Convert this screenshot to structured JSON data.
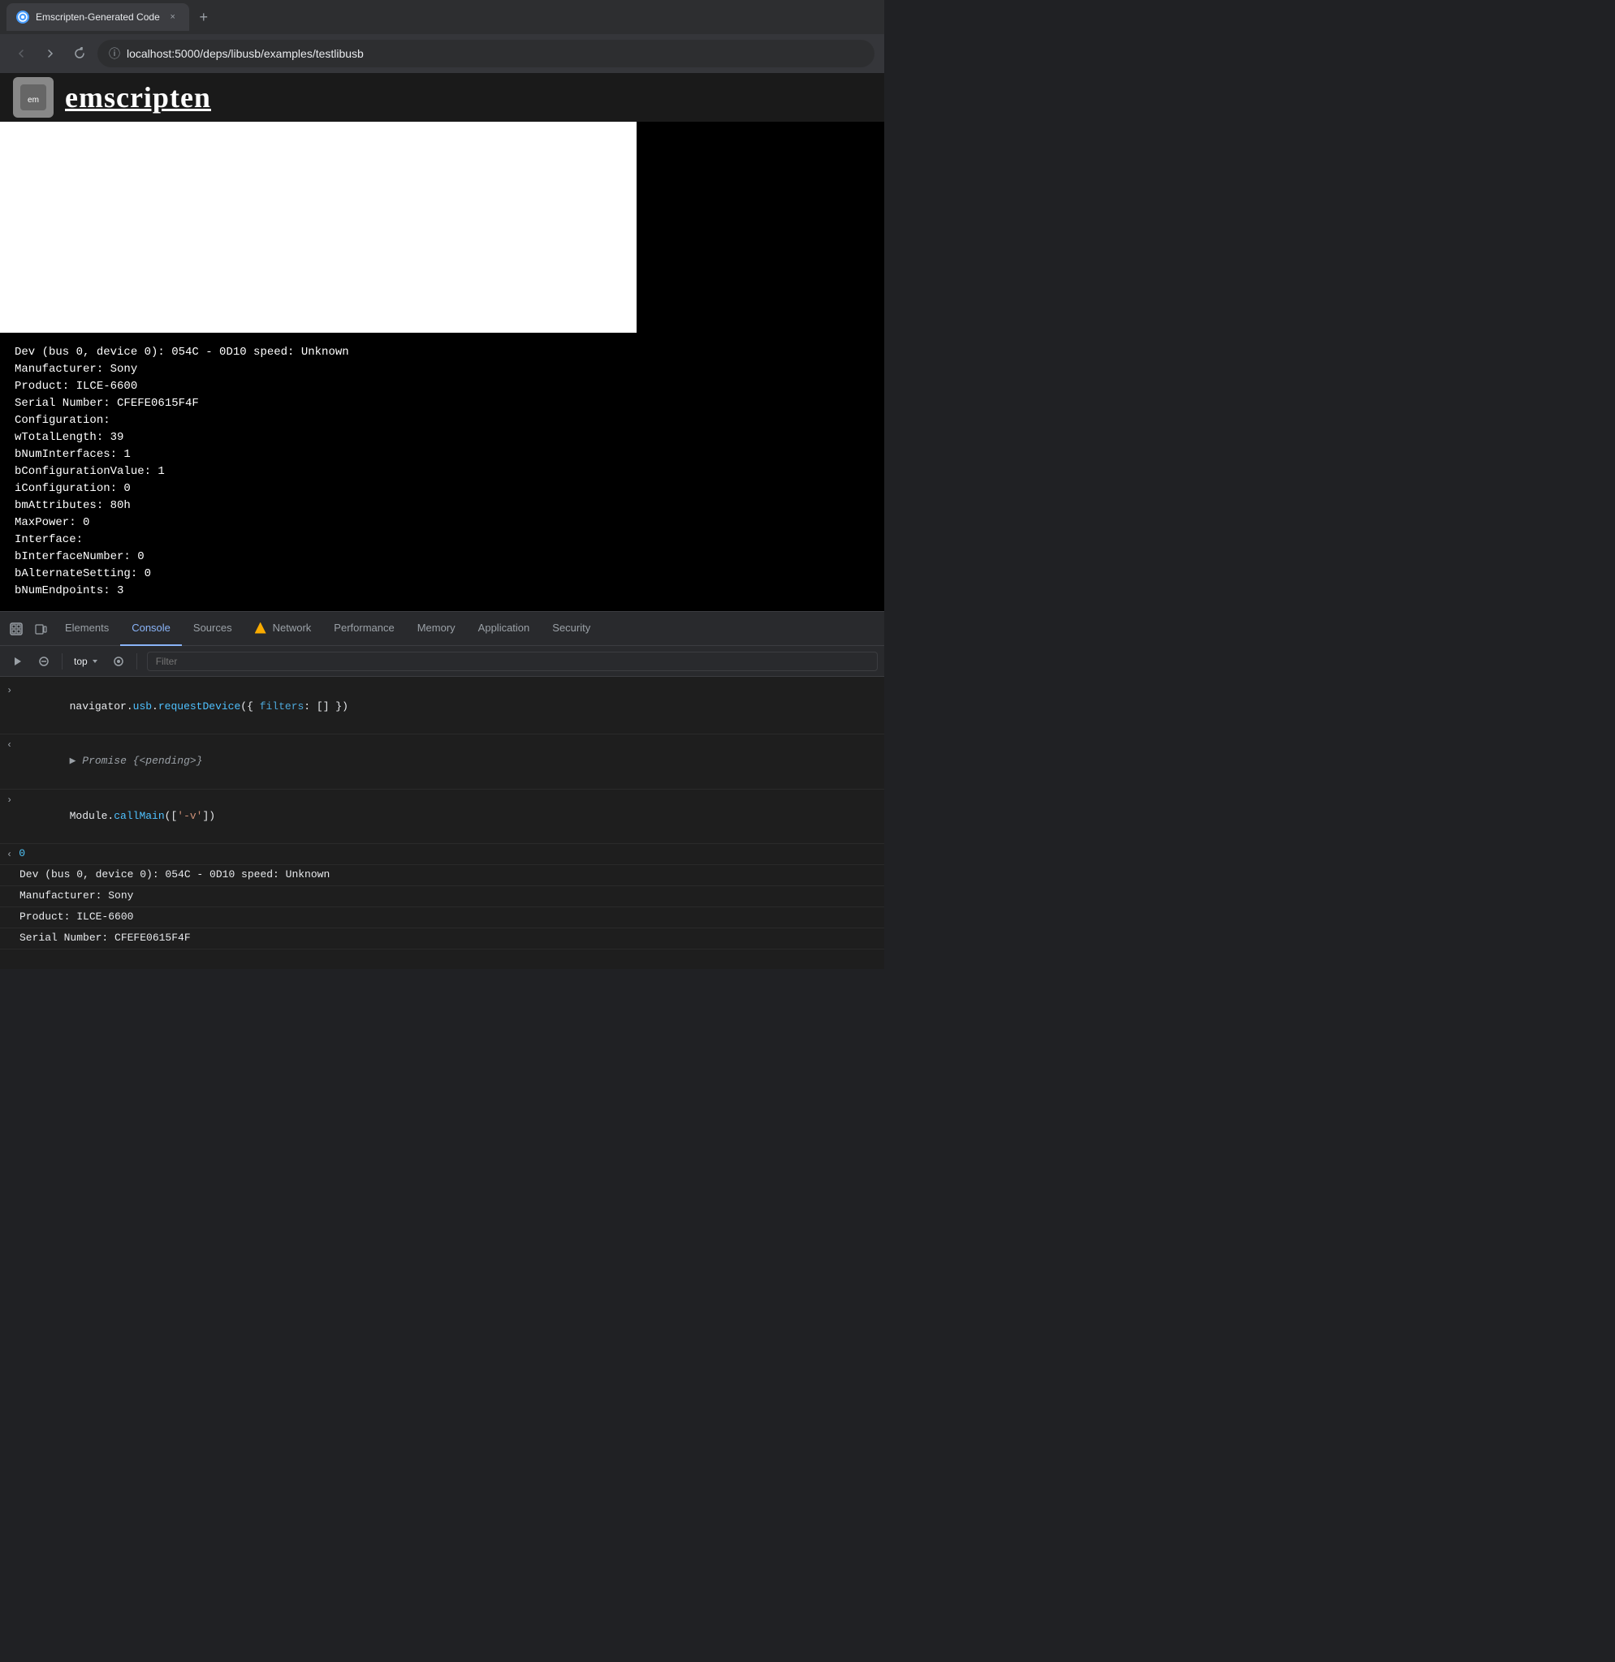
{
  "browser": {
    "tab_title": "Emscripten-Generated Code",
    "url": "localhost:5000/deps/libusb/examples/testlibusb",
    "close_label": "×",
    "new_tab_label": "+"
  },
  "devtools": {
    "tabs": [
      {
        "id": "elements",
        "label": "Elements",
        "active": false
      },
      {
        "id": "console",
        "label": "Console",
        "active": true
      },
      {
        "id": "sources",
        "label": "Sources",
        "active": false
      },
      {
        "id": "network",
        "label": "Network",
        "active": false,
        "warning": true
      },
      {
        "id": "performance",
        "label": "Performance",
        "active": false
      },
      {
        "id": "memory",
        "label": "Memory",
        "active": false
      },
      {
        "id": "application",
        "label": "Application",
        "active": false
      },
      {
        "id": "security",
        "label": "Security",
        "active": false
      }
    ],
    "toolbar": {
      "context": "top",
      "filter_placeholder": "Filter"
    }
  },
  "terminal": {
    "line1": "Dev (bus 0, device 0): 054C - 0D10 speed: Unknown",
    "line2": "  Manufacturer:                 Sony",
    "line3": "  Product:                      ILCE-6600",
    "line4": "  Serial Number:                CFEFE0615F4F",
    "line5": "  Configuration:",
    "line6": "    wTotalLength:                39",
    "line7": "    bNumInterfaces:              1",
    "line8": "    bConfigurationValue:         1",
    "line9": "    iConfiguration:              0",
    "line10": "    bmAttributes:               80h",
    "line11": "    MaxPower:                    0",
    "line12": "  Interface:",
    "line13": "    bInterfaceNumber:            0",
    "line14": "    bAlternateSetting:           0",
    "line15": "    bNumEndpoints:               3"
  },
  "console_lines": [
    {
      "type": "input",
      "direction": "right",
      "content": "navigator.usb.requestDevice({ filters: [] })"
    },
    {
      "type": "output",
      "direction": "left",
      "content": "Promise {<pending>}",
      "italic": true
    },
    {
      "type": "input",
      "direction": "right",
      "content": "Module.callMain(['-v'])"
    },
    {
      "type": "output",
      "direction": "left",
      "content": "0",
      "is_number": true
    }
  ],
  "console_output": {
    "line1": "Dev (bus 0, device 0): 054C - 0D10 speed: Unknown",
    "line2": "  Manufacturer:                 Sony",
    "line3": "  Product:                      ILCE-6600",
    "line4": "  Serial Number:                CFEFE0615F4F"
  },
  "emscripten_title": "emscripten"
}
